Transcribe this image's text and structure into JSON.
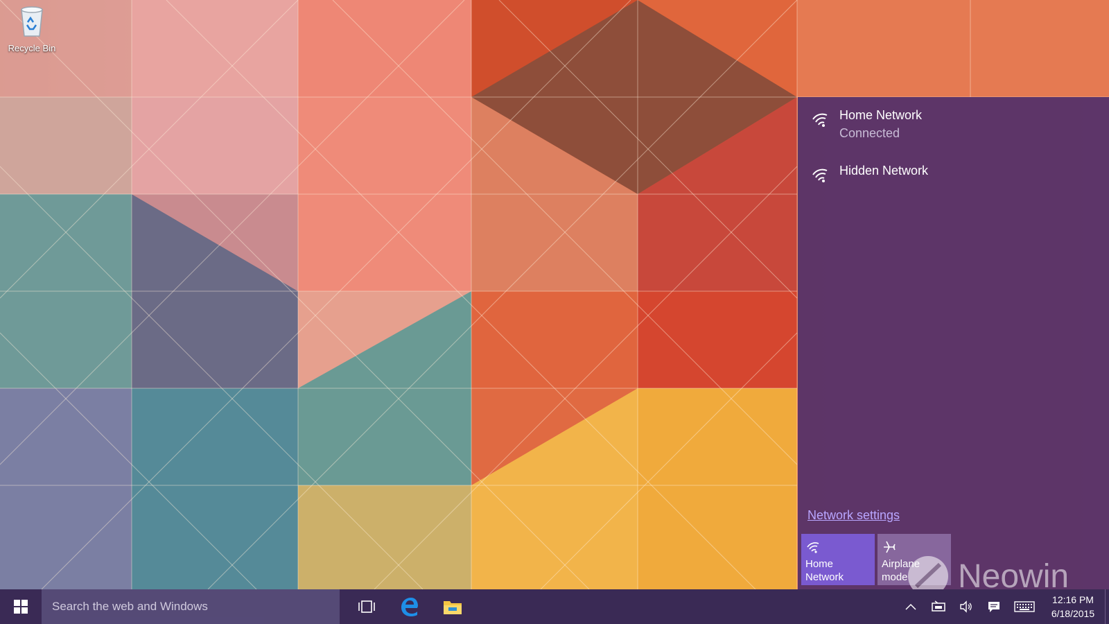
{
  "desktop": {
    "icons": [
      {
        "label": "Recycle Bin",
        "icon": "recycle-bin-icon"
      }
    ]
  },
  "network_flyout": {
    "networks": [
      {
        "name": "Home Network",
        "status": "Connected",
        "icon": "wifi-icon"
      },
      {
        "name": "Hidden Network",
        "status": "",
        "icon": "wifi-icon"
      }
    ],
    "settings_link": "Network settings",
    "quick_actions": [
      {
        "label_line1": "Home",
        "label_line2": "Network",
        "icon": "wifi-icon",
        "active": true
      },
      {
        "label_line1": "Airplane mode",
        "label_line2": "",
        "icon": "airplane-icon",
        "active": false
      }
    ]
  },
  "watermark": {
    "text": "Neowin"
  },
  "taskbar": {
    "search_placeholder": "Search the web and Windows",
    "pinned": [
      {
        "name": "task-view",
        "icon": "task-view-icon"
      },
      {
        "name": "edge",
        "icon": "edge-icon"
      },
      {
        "name": "file-explorer",
        "icon": "folder-icon"
      }
    ],
    "tray": {
      "time": "12:16 PM",
      "date": "6/18/2015"
    }
  },
  "colors": {
    "flyout_bg": "#53306b",
    "taskbar_bg": "#3a2a55",
    "accent": "#7a5ad0",
    "link": "#b9a6ff"
  }
}
